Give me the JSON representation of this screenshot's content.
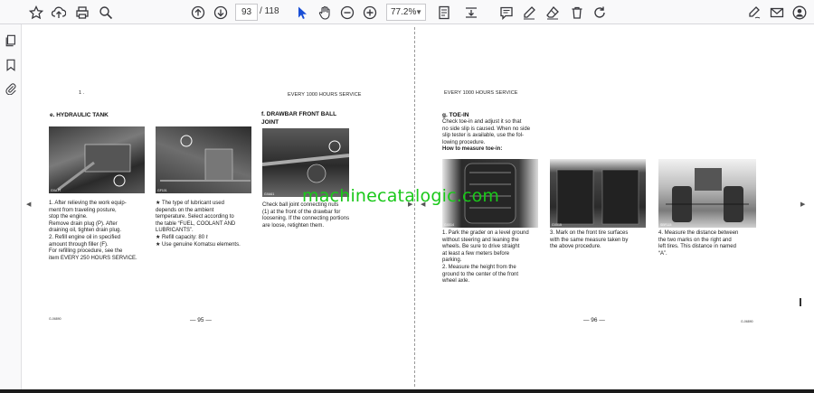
{
  "toolbar": {
    "page_current": "93",
    "page_total": "/ 118",
    "zoom": "77.2%",
    "icons": [
      "bookmark-star-icon",
      "upload-icon",
      "print-icon",
      "search-icon",
      "arrow-up-icon",
      "arrow-down-icon",
      "cursor-icon",
      "hand-icon",
      "zoom-out-icon",
      "zoom-in-icon",
      "page-fit-icon",
      "fit-width-icon",
      "comment-icon",
      "draw-icon",
      "eraser-icon",
      "delete-icon",
      "rotate-icon",
      "edit-sign-icon",
      "mail-icon",
      "account-icon"
    ]
  },
  "sidebar": {
    "icons": [
      "pages-icon",
      "bookmark-icon",
      "attachment-icon"
    ]
  },
  "watermark": "machinecatalogic.com",
  "left_page": {
    "corner_mark": "1 .",
    "header": "EVERY 1000 HOURS SERVICE",
    "section_e_title": "e.  HYDRAULIC TANK",
    "section_e_body": [
      "1. After relieving the work equip-",
      "    ment from traveling posture,",
      "    stop the engine.",
      "    Remove drain plug (P). After",
      "    draining oil, tighten drain plug.",
      "2. Refill engine oil in specified",
      "    amount through filler (F).",
      "    For refilling procedure, see the",
      "item EVERY 250 HOURS SERVICE."
    ],
    "note_body": [
      "★  The type of lubricant used",
      "    depends on the ambient",
      "    temperature. Select according to",
      "    the table “FUEL, COOLANT AND",
      "    LUBRICANTS”.",
      "★  Refill capacity: 80 ℓ",
      "★  Use genuine Komatsu elements."
    ],
    "section_f_title_1": "f.  DRAWBAR FRONT BALL",
    "section_f_title_2": "    JOINT",
    "section_f_body": [
      "  Check ball joint connecting nuts",
      "(1) at the front of the drawbar for",
      "loosening. If the connecting portions",
      "are loose, retighten them."
    ],
    "page_number": "— 95 —",
    "code": "G-06890",
    "photo_labels": [
      "GXA77",
      "GF101",
      "GXA61"
    ]
  },
  "right_page": {
    "header": "EVERY 1000 HOURS SERVICE",
    "section_g_title": "g.  TOE-IN",
    "section_g_body": [
      "    Check toe-in and adjust it so that",
      "no side slip is caused. When no side",
      "slip tester is available, use the fol-",
      "lowing procedure."
    ],
    "how_to": "How to measure toe-in:",
    "step1": [
      "1. Park the grader on a level ground",
      "    without steering and leaning the",
      "    wheels. Be sure to drive straight",
      "    at least a few meters before",
      "    parking.",
      "2. Measure the height from the",
      "    ground to the center of the front",
      "    wheel axle."
    ],
    "step3": [
      "3. Mark on the front tire surfaces",
      "    with the same measure taken by",
      "    the above procedure."
    ],
    "step4": [
      "4. Measure the distance between",
      "    the two marks on the right and",
      "    left tires. This distance in named",
      "    “A”."
    ],
    "page_number": "— 96 —",
    "code": "G-06890",
    "photo_labels": [
      "GX014",
      "GX015",
      "SBF115"
    ]
  }
}
